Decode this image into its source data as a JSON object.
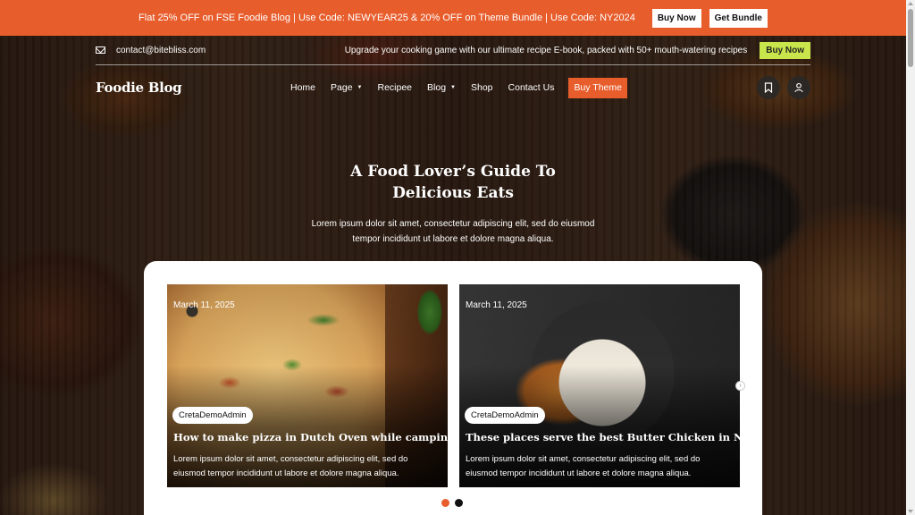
{
  "promo": {
    "text": "Flat 25% OFF on FSE Foodie Blog | Use Code: NEWYEAR25 & 20% OFF on Theme Bundle | Use Code: NY2024",
    "buy_now": "Buy Now",
    "get_bundle": "Get Bundle",
    "color": "#e85d2c"
  },
  "topbar": {
    "email": "contact@bitebliss.com",
    "announcement": "Upgrade your cooking game with our ultimate recipe E-book, packed with 50+ mouth-watering recipes",
    "buy_now": "Buy Now",
    "buy_now_color": "#c8e64b"
  },
  "nav": {
    "logo": "Foodie Blog",
    "items": [
      {
        "label": "Home",
        "has_dropdown": false
      },
      {
        "label": "Page",
        "has_dropdown": true
      },
      {
        "label": "Recipee",
        "has_dropdown": false
      },
      {
        "label": "Blog",
        "has_dropdown": true
      },
      {
        "label": "Shop",
        "has_dropdown": false
      },
      {
        "label": "Contact Us",
        "has_dropdown": false
      }
    ],
    "buy_theme": "Buy Theme",
    "icons": [
      "bookmark-icon",
      "user-icon"
    ]
  },
  "hero": {
    "title_line1": "A Food Lover’s Guide To",
    "title_line2": "Delicious Eats",
    "description": "Lorem ipsum dolor sit amet, consectetur adipiscing elit, sed do eiusmod tempor incididunt ut labore et dolore magna aliqua."
  },
  "posts": [
    {
      "date": "March 11, 2025",
      "author": "CretaDemoAdmin",
      "title": "How to make pizza in Dutch Oven while camping?",
      "excerpt": "Lorem ipsum dolor sit amet, consectetur adipiscing elit, sed do eiusmod tempor incididunt ut labore et dolore magna aliqua."
    },
    {
      "date": "March 11, 2025",
      "author": "CretaDemoAdmin",
      "title": "These places serve the best Butter Chicken in NYC",
      "excerpt": "Lorem ipsum dolor sit amet, consectetur adipiscing elit, sed do eiusmod tempor incididunt ut labore et dolore magna aliqua."
    }
  ],
  "slider": {
    "active_dot_color": "#e85d2c",
    "inactive_dot_color": "#111111"
  }
}
